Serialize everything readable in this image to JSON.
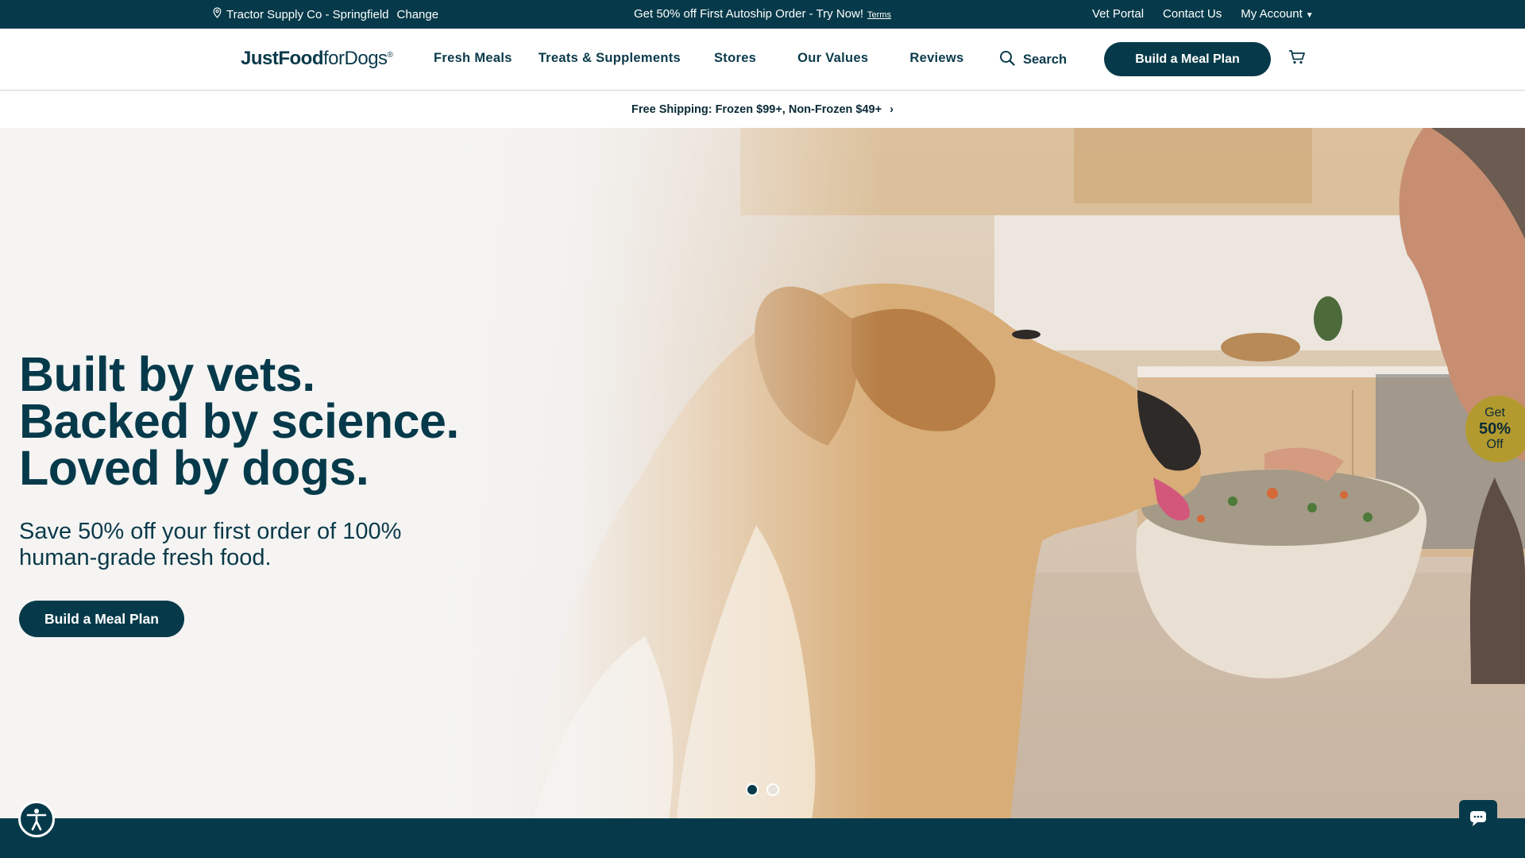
{
  "topbar": {
    "location": "Tractor Supply Co - Springfield",
    "change": "Change",
    "promo": "Get 50% off First Autoship Order - Try Now!",
    "terms": "Terms",
    "vet_portal": "Vet Portal",
    "contact": "Contact Us",
    "account": "My Account"
  },
  "nav": {
    "logo_bold": "JustFood",
    "logo_light": "forDogs",
    "logo_reg": "®",
    "links": [
      "Fresh Meals",
      "Treats & Supplements",
      "Stores",
      "Our Values",
      "Reviews"
    ],
    "search": "Search",
    "cta": "Build a Meal Plan"
  },
  "shipbar": {
    "text": "Free Shipping: Frozen $99+, Non-Frozen $49+",
    "chevron": "›"
  },
  "hero": {
    "headline": [
      "Built by vets.",
      "Backed by science.",
      "Loved by dogs."
    ],
    "sub": "Save 50% off your first order of 100% human-grade fresh food.",
    "cta": "Build a Meal Plan",
    "slides": {
      "current": 1,
      "total": 2
    }
  },
  "badge": {
    "get": "Get",
    "pct": "50%",
    "off": "Off"
  },
  "icons": {
    "location": "location-pin-icon",
    "search": "search-icon",
    "cart": "cart-icon",
    "accessibility": "accessibility-icon",
    "chat": "chat-icon"
  },
  "colors": {
    "brand": "#063a4a",
    "badge": "#b39a2f",
    "background": "#f5f4f3"
  }
}
